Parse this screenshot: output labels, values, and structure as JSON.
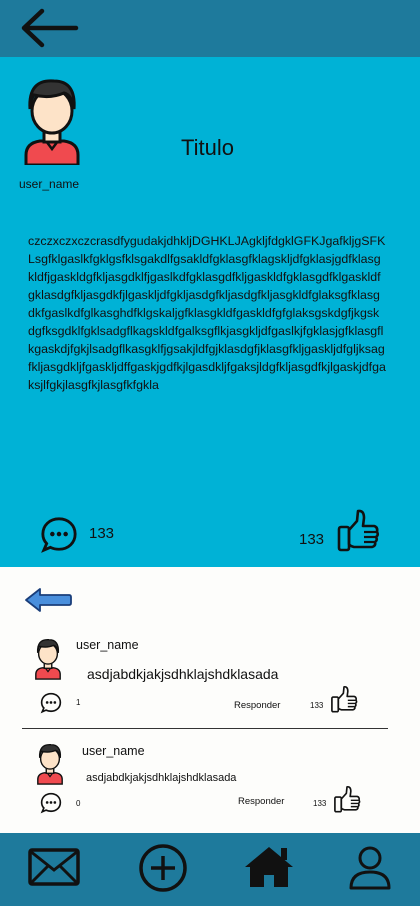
{
  "topbar": {
    "back_icon": "arrow-left-icon"
  },
  "post": {
    "author": "user_name",
    "title": "Titulo",
    "body": "czczxczxczcrasdfygudakjdhkljDGHKLJAgkljfdgklGFKJgafkljgSFKLsgfklgaslkfgklgsfklsgakdlfgsakldfgklasgfklagskljdfgklasjgdfklasgkldfjgaskldgfkljasgdklfjgaslkdfgklasgdfkljgaskldfgklasgdfklgaskldfgklasdgfkljasgdkfjlgaskljdfgkljasdgfkljasdgfkljasgkldfglaksgfklasgdkfgaslkdfglkasghdfklgskaljgfklasgkldfgaskldfgfglaksgskdgfjkgskdgfksgdklfgklsadgflkagskldfgalksgflkjasgkljdfgaslkjfgklasjgfklasgflkgaskdjfgkjlsadgflkasgklfjgsakjldfgjklasdgfjklasgfkljgaskljdfgljksagfkljasgdkljfgaskljdffgaskjgdfkjlgasdkljfgaksjldgfkljasgdfkjlgaskjdfgaksjlfgkjlasgfkjlasgfkfgkla",
    "comment_count": "133",
    "like_count": "133",
    "colors": {
      "background": "#00b2d6",
      "bars": "#1e7a9c"
    }
  },
  "comments": [
    {
      "user": "user_name",
      "text": "asdjabdkjakjsdhklajshdklasada",
      "reply_count": "1",
      "reply_label": "Responder",
      "like_count": "133"
    },
    {
      "user": "user_name",
      "text": "asdjabdkjakjsdhklajshdklasada",
      "reply_count": "0",
      "reply_label": "Responder",
      "like_count": "133"
    }
  ],
  "bottom_nav": {
    "items": [
      "mail-icon",
      "add-circle-icon",
      "home-icon",
      "profile-icon"
    ]
  }
}
